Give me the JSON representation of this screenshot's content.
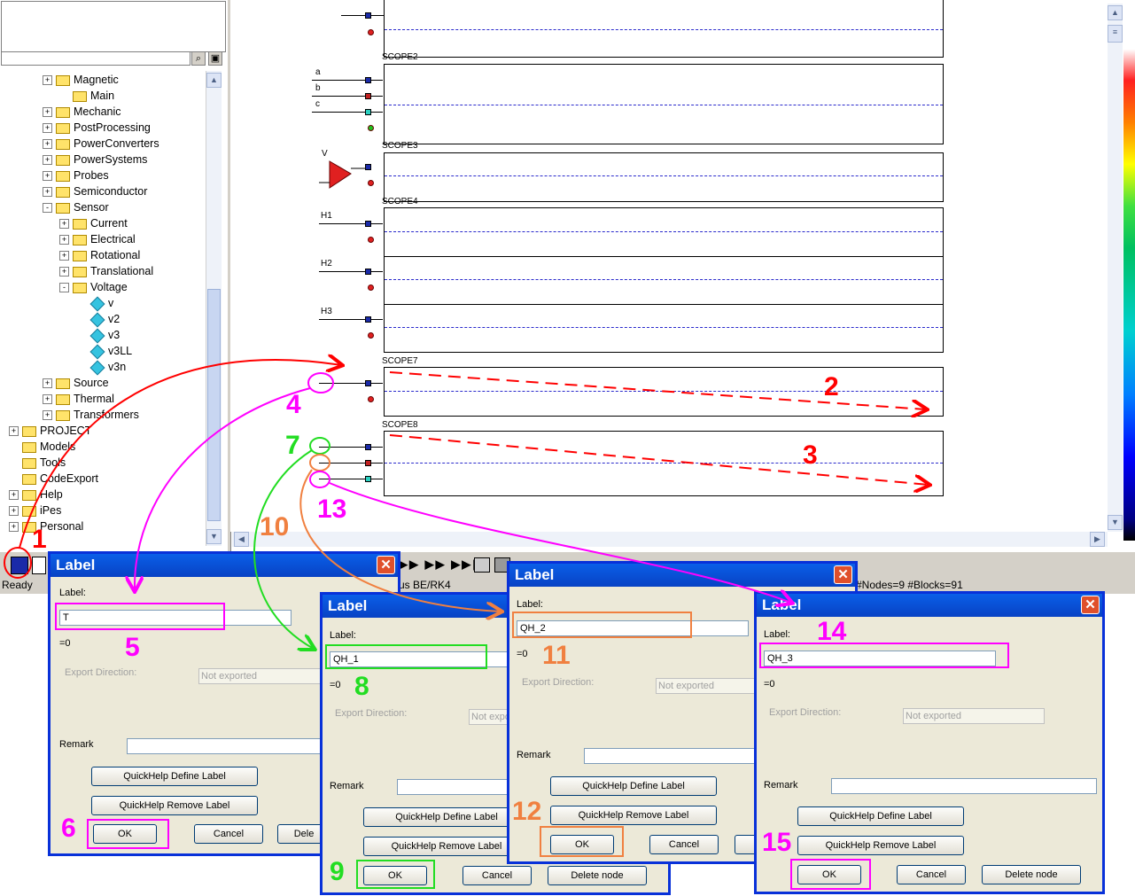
{
  "tree": {
    "items": [
      {
        "label": "Magnetic",
        "type": "folder",
        "expander": "+"
      },
      {
        "label": "Main",
        "type": "folder",
        "expander": ""
      },
      {
        "label": "Mechanic",
        "type": "folder",
        "expander": "+"
      },
      {
        "label": "PostProcessing",
        "type": "folder",
        "expander": "+"
      },
      {
        "label": "PowerConverters",
        "type": "folder",
        "expander": "+"
      },
      {
        "label": "PowerSystems",
        "type": "folder",
        "expander": "+"
      },
      {
        "label": "Probes",
        "type": "folder",
        "expander": "+"
      },
      {
        "label": "Semiconductor",
        "type": "folder",
        "expander": "+"
      },
      {
        "label": "Sensor",
        "type": "folder",
        "expander": "-"
      },
      {
        "label": "Current",
        "type": "folder",
        "expander": "+"
      },
      {
        "label": "Electrical",
        "type": "folder",
        "expander": "+"
      },
      {
        "label": "Rotational",
        "type": "folder",
        "expander": "+"
      },
      {
        "label": "Translational",
        "type": "folder",
        "expander": "+"
      },
      {
        "label": "Voltage",
        "type": "folder",
        "expander": "-"
      },
      {
        "label": "v",
        "type": "leaf",
        "expander": ""
      },
      {
        "label": "v2",
        "type": "leaf",
        "expander": ""
      },
      {
        "label": "v3",
        "type": "leaf",
        "expander": ""
      },
      {
        "label": "v3LL",
        "type": "leaf",
        "expander": ""
      },
      {
        "label": "v3n",
        "type": "leaf",
        "expander": ""
      },
      {
        "label": "Source",
        "type": "folder",
        "expander": "+"
      },
      {
        "label": "Thermal",
        "type": "folder",
        "expander": "+"
      },
      {
        "label": "Transformers",
        "type": "folder",
        "expander": "+"
      },
      {
        "label": "PROJECT",
        "type": "folder",
        "expander": "+"
      },
      {
        "label": "Models",
        "type": "folder",
        "expander": ""
      },
      {
        "label": "Tools",
        "type": "folder",
        "expander": ""
      },
      {
        "label": "CodeExport",
        "type": "folder",
        "expander": ""
      },
      {
        "label": "Help",
        "type": "folder",
        "expander": "+"
      },
      {
        "label": "iPes",
        "type": "folder",
        "expander": "+"
      },
      {
        "label": "Personal",
        "type": "folder",
        "expander": "+"
      }
    ]
  },
  "scopes": {
    "s2": "SCOPE2",
    "s3": "SCOPE3",
    "s4": "SCOPE4",
    "s7": "SCOPE7",
    "s8": "SCOPE8"
  },
  "signals": {
    "a": "a",
    "b": "b",
    "c": "c",
    "v": "V",
    "h1": "H1",
    "h2": "H2",
    "h3": "H3"
  },
  "status": {
    "ready": "Ready",
    "solver": "us BE/RK4",
    "counts": "#Nodes=9  #Blocks=91"
  },
  "dialog": {
    "title": "Label",
    "label_caption": "Label:",
    "value_text": "=0",
    "export_caption": "Export Direction:",
    "export_value": "Not exported",
    "remark_caption": "Remark",
    "quickhelp_define": "QuickHelp Define Label",
    "quickhelp_remove": "QuickHelp Remove Label",
    "ok": "OK",
    "cancel": "Cancel",
    "delete": "Delete node",
    "delete_short": "Dele"
  },
  "dialogs": {
    "d1": {
      "label_value": "T"
    },
    "d2": {
      "label_value": "QH_1"
    },
    "d3": {
      "label_value": "QH_2"
    },
    "d4": {
      "label_value": "QH_3"
    }
  },
  "annotations": {
    "n1": "1",
    "n2": "2",
    "n3": "3",
    "n4": "4",
    "n5": "5",
    "n6": "6",
    "n7": "7",
    "n8": "8",
    "n9": "9",
    "n10": "10",
    "n11": "11",
    "n12": "12",
    "n13": "13",
    "n14": "14",
    "n15": "15"
  },
  "colors": {
    "title_blue": "#0a5fe8",
    "magenta": "#ff00ff",
    "green": "#22dd22",
    "orange": "#f08040",
    "red": "#ff0000"
  }
}
